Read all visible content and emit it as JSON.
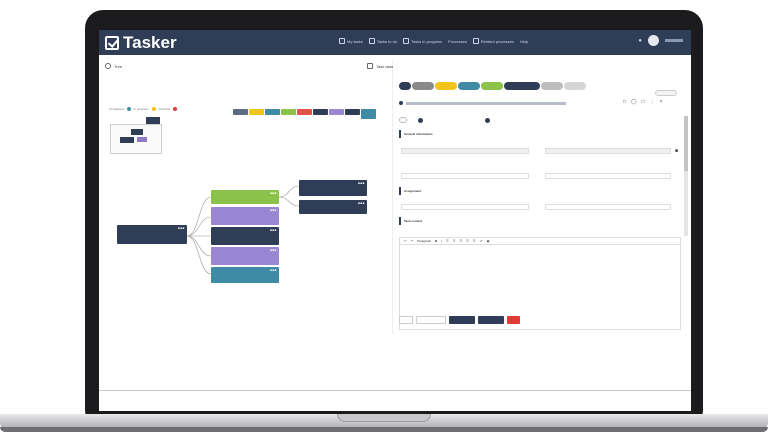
{
  "app": {
    "name": "Tasker"
  },
  "nav": {
    "items": [
      {
        "label": "My tasks",
        "icon": "inbox-icon"
      },
      {
        "label": "Tasks to do",
        "icon": "checklist-icon"
      },
      {
        "label": "Tasks in progress",
        "icon": "progress-icon"
      },
      {
        "label": "Processes",
        "icon": "process-icon"
      },
      {
        "label": "Related processes",
        "icon": "link-icon"
      },
      {
        "label": "Help",
        "icon": "help-icon"
      }
    ],
    "bell_icon": "bell-icon",
    "user_avatar_icon": "user-icon"
  },
  "tree_panel": {
    "title": "Tree",
    "icon": "tree-icon",
    "legend": [
      {
        "label": "Completed",
        "color": "#3f8aa5"
      },
      {
        "label": "In progress",
        "color": "#f0c419"
      },
      {
        "label": "Overdue",
        "color": "#e53935"
      }
    ],
    "chips": [
      "#5a6b86",
      "#f0c419",
      "#3f8aa5",
      "#8bc34a",
      "#e0554a",
      "#2f3d57",
      "#9b86d3",
      "#2f3d57",
      "#3f8aa5"
    ],
    "nodes": [
      {
        "id": "root",
        "title": "Root task",
        "color": "navy"
      },
      {
        "id": "n1",
        "title": "Subtask",
        "color": "green"
      },
      {
        "id": "n2",
        "title": "Subtask",
        "color": "purple"
      },
      {
        "id": "n3",
        "title": "Subtask",
        "color": "navy"
      },
      {
        "id": "n4",
        "title": "Subtask",
        "color": "purple"
      },
      {
        "id": "n5",
        "title": "Subtask",
        "color": "teal"
      },
      {
        "id": "r1",
        "title": "Subtask",
        "color": "navy"
      },
      {
        "id": "r2",
        "title": "Subtask",
        "color": "navy"
      }
    ]
  },
  "detail_panel": {
    "title": "Task data",
    "icon": "edit-icon",
    "steps": [
      "#2f3d57",
      "#8a8a8a",
      "#f0c419",
      "#3f8aa5",
      "#8bc34a",
      "#2f3d57",
      "#bdbdbd",
      "#d6d6d6"
    ],
    "tabs": [
      {
        "label": "Task data",
        "active": true
      },
      {
        "label": "Activity",
        "badge": true
      },
      {
        "label": "Requests"
      },
      {
        "label": "Documents"
      },
      {
        "label": "Related tasks"
      },
      {
        "label": "Time entries"
      },
      {
        "label": "Communication",
        "badge": true
      },
      {
        "label": "Checklist"
      }
    ],
    "sections": {
      "general": "General information",
      "assignment": "Assignment",
      "description": "Task content"
    },
    "editor": {
      "format_label": "Paragraph"
    },
    "buttons": [
      {
        "label": "Cancel",
        "style": "plain"
      },
      {
        "label": "Save and close",
        "style": "plain"
      },
      {
        "label": "Save and send",
        "style": "navy"
      },
      {
        "label": "Save changes",
        "style": "navy"
      },
      {
        "label": "Delete",
        "style": "red"
      }
    ]
  },
  "colors": {
    "nav": "#2f3d57",
    "navy": "#2f3d57",
    "green": "#8bc34a",
    "purple": "#9b86d3",
    "teal": "#3f8aa5",
    "red": "#e53935"
  }
}
